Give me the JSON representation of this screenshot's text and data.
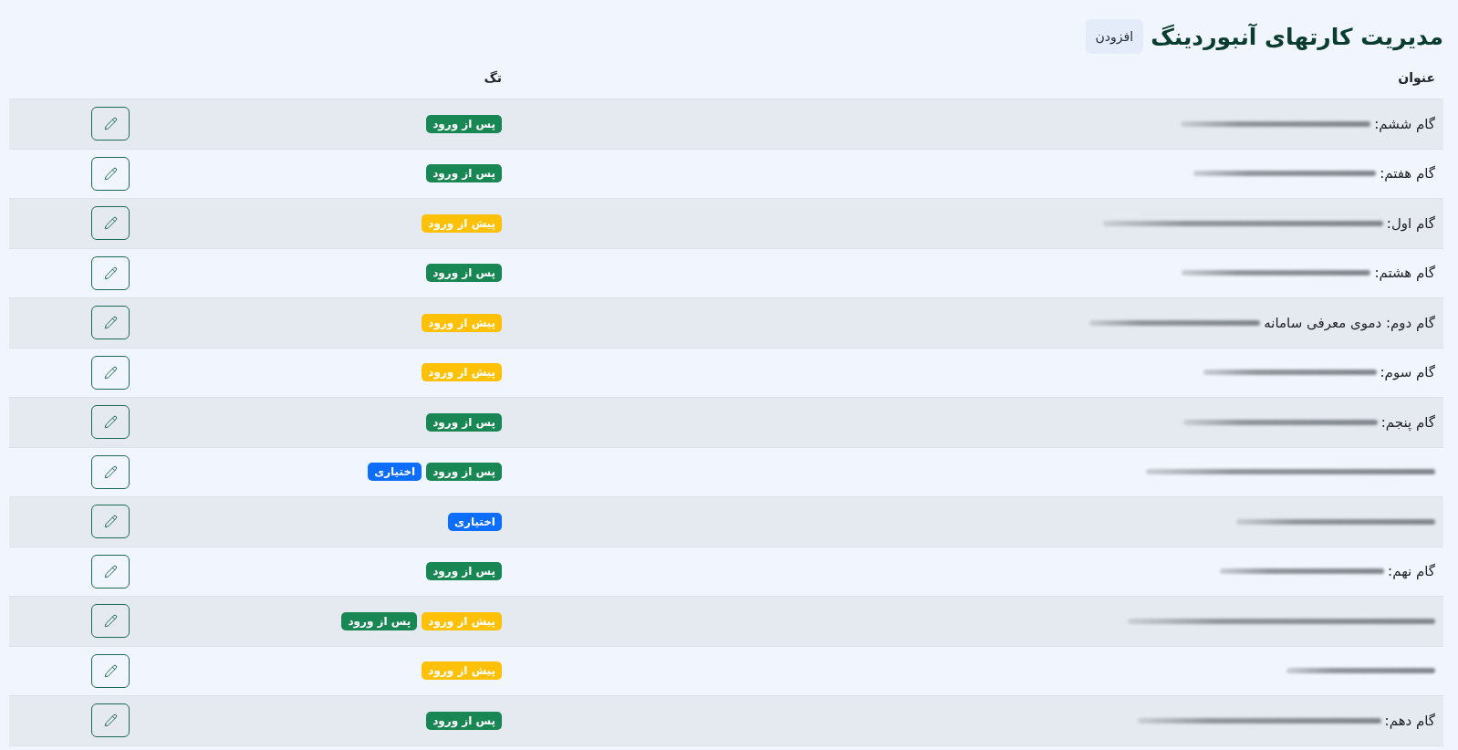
{
  "page": {
    "title": "مدیریت کارتهای آنبوردینگ",
    "add_button": "افزودن"
  },
  "table": {
    "columns": [
      "عنوان",
      "تگ"
    ],
    "rows": [
      {
        "title": "گام ششم:",
        "redacted": true,
        "tags": [
          {
            "label": "پس از ورود",
            "color": "#198754"
          }
        ]
      },
      {
        "title": "گام هفتم:",
        "redacted": true,
        "tags": [
          {
            "label": "پس از ورود",
            "color": "#198754"
          }
        ]
      },
      {
        "title": "گام اول:",
        "redacted": true,
        "tags": [
          {
            "label": "پیش از ورود",
            "color": "#ffc107"
          }
        ]
      },
      {
        "title": "گام هشتم:",
        "redacted": true,
        "tags": [
          {
            "label": "پس از ورود",
            "color": "#198754"
          }
        ]
      },
      {
        "title": "گام دوم: دموی معرفی سامانه",
        "redacted": true,
        "tags": [
          {
            "label": "پیش از ورود",
            "color": "#ffc107"
          }
        ]
      },
      {
        "title": "گام سوم:",
        "redacted": true,
        "tags": [
          {
            "label": "پیش از ورود",
            "color": "#ffc107"
          }
        ]
      },
      {
        "title": "گام پنجم:",
        "redacted": true,
        "tags": [
          {
            "label": "پس از ورود",
            "color": "#198754"
          }
        ]
      },
      {
        "redacted": true,
        "tags": [
          {
            "label": "پس از ورود",
            "color": "#198754"
          },
          {
            "label": "اختیاری",
            "color": "#0d6efd"
          }
        ]
      },
      {
        "redacted": true,
        "tags": [
          {
            "label": "اختیاری",
            "color": "#0d6efd"
          }
        ]
      },
      {
        "title": "گام نهم:",
        "redacted": true,
        "tags": [
          {
            "label": "پس از ورود",
            "color": "#198754"
          }
        ]
      },
      {
        "redacted": true,
        "tags": [
          {
            "label": "پیش از ورود",
            "color": "#ffc107"
          },
          {
            "label": "پس از ورود",
            "color": "#198754"
          }
        ]
      },
      {
        "redacted": true,
        "tags": [
          {
            "label": "پیش از ورود",
            "color": "#ffc107"
          }
        ]
      },
      {
        "title": "گام دهم:",
        "redacted": true,
        "tags": [
          {
            "label": "پس از ورود",
            "color": "#198754"
          }
        ]
      }
    ]
  }
}
